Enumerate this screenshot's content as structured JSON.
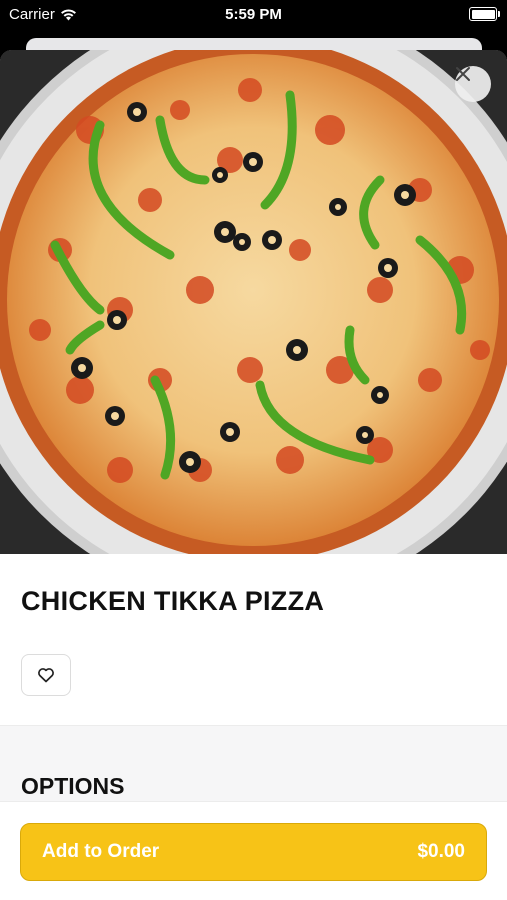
{
  "status_bar": {
    "carrier": "Carrier",
    "time": "5:59 PM"
  },
  "item": {
    "title": "CHICKEN TIKKA PIZZA"
  },
  "sections": {
    "options_heading": "OPTIONS"
  },
  "cart": {
    "add_label": "Add to Order",
    "price": "$0.00"
  },
  "colors": {
    "accent": "#f7c317",
    "accent_border": "#d9a90a",
    "text": "#111111"
  },
  "icons": {
    "close": "close-icon",
    "favorite": "heart-icon",
    "wifi": "wifi-icon",
    "battery": "battery-icon"
  }
}
